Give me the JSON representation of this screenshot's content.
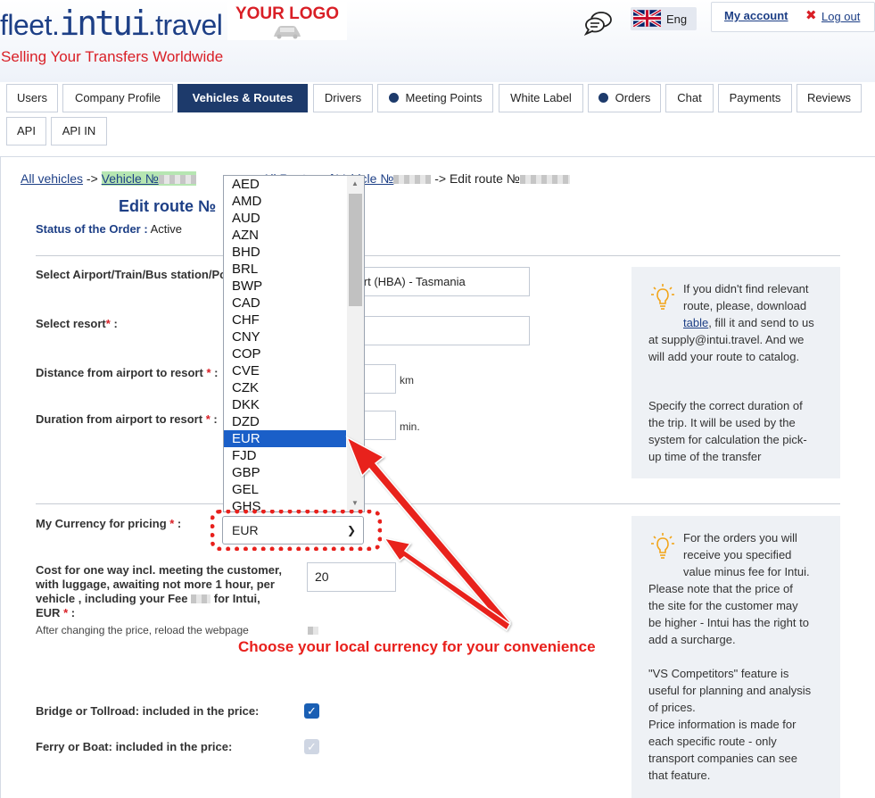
{
  "header": {
    "brand_prefix": "fleet.",
    "brand_main": "intui",
    "brand_suffix": ".travel",
    "tagline": "Selling Your Transfers Worldwide",
    "your_logo": "YOUR LOGO",
    "language": "Eng",
    "my_account": "My account",
    "logout": "Log out"
  },
  "tabs": [
    {
      "label": "Users"
    },
    {
      "label": "Company Profile"
    },
    {
      "label": "Vehicles & Routes",
      "active": true
    },
    {
      "label": "Drivers"
    },
    {
      "label": "Meeting Points",
      "dot": true
    },
    {
      "label": "White Label"
    },
    {
      "label": "Orders",
      "dot": true
    },
    {
      "label": "Chat"
    },
    {
      "label": "Payments"
    },
    {
      "label": "Reviews"
    },
    {
      "label": "API"
    },
    {
      "label": "API IN"
    }
  ],
  "breadcrumb": {
    "all_vehicles": "All vehicles",
    "sep": "->",
    "vehicle": "Vehicle №",
    "all_routes": "All Routes of Vehicle №",
    "current": "Edit route №"
  },
  "form": {
    "title": "Edit route №",
    "status_label": "Status of the Order :",
    "status_value": "Active",
    "airport_label": "Select Airport/Train/Bus station/Po",
    "airport_value": "rport (HBA) - Tasmania",
    "resort_label": "Select resort",
    "distance_label": "Distance from airport to resort",
    "distance_unit": "km",
    "duration_label": "Duration from airport to resort",
    "duration_unit": "min.",
    "currency_label": "My Currency for pricing",
    "currency_value": "EUR",
    "cost_label_1": "Cost for one way incl. meeting the customer,",
    "cost_label_2": "with luggage, awaiting not more 1 hour, per",
    "cost_label_3": "vehicle , including your Fee",
    "cost_label_3b": "for Intui,",
    "cost_label_4": "EUR",
    "cost_value": "20",
    "cost_note": "After changing the price, reload the webpage",
    "bridge_label": "Bridge or Tollroad: included in the price:",
    "ferry_label": "Ferry or Boat: included in the price:",
    "colon": " :"
  },
  "info1": {
    "line1": "If you didn't find relevant",
    "line2": "route, please, download",
    "link": "table",
    "line3_rest": ", fill it and send to us",
    "line4": "at supply@intui.travel. And we",
    "line5": "will add your route to catalog.",
    "p2_1": "Specify the correct duration of",
    "p2_2": "the trip. It will be used by the",
    "p2_3": "system for calculation the pick-",
    "p2_4": "up time of the transfer"
  },
  "info2": {
    "l1": "For the orders you will",
    "l2": "receive you specified",
    "l3": "value minus fee for Intui.",
    "l4": "Please note that the price of",
    "l5": "the site for the customer may",
    "l6": "be higher - Intui has the right to",
    "l7": "add a surcharge.",
    "l8": "\"VS Competitors\" feature is",
    "l9": "useful for planning and analysis",
    "l10": "of prices.",
    "l11": "Price information is made for",
    "l12": "each specific route - only",
    "l13": "transport companies can see",
    "l14": "that feature."
  },
  "currency_options": [
    "AED",
    "AMD",
    "AUD",
    "AZN",
    "BHD",
    "BRL",
    "BWP",
    "CAD",
    "CHF",
    "CNY",
    "COP",
    "CVE",
    "CZK",
    "DKK",
    "DZD",
    "EUR",
    "FJD",
    "GBP",
    "GEL",
    "GHS"
  ],
  "selected_currency": "EUR",
  "annotation": "Choose your local currency for your convenience",
  "colors": {
    "brand": "#1d3f86",
    "accent": "#d91f26",
    "active_tab": "#1d3a6b",
    "selection": "#1a5fc8",
    "annotation": "#e8201c"
  }
}
